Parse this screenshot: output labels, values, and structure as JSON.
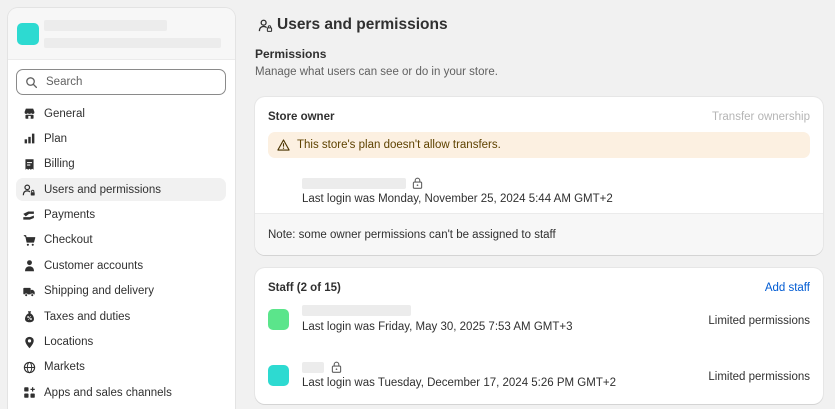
{
  "sidebar": {
    "search_placeholder": "Search",
    "items": [
      {
        "label": "General",
        "icon": "store-icon"
      },
      {
        "label": "Plan",
        "icon": "plan-icon"
      },
      {
        "label": "Billing",
        "icon": "billing-icon"
      },
      {
        "label": "Users and permissions",
        "icon": "users-icon",
        "active": true
      },
      {
        "label": "Payments",
        "icon": "payments-icon"
      },
      {
        "label": "Checkout",
        "icon": "cart-icon"
      },
      {
        "label": "Customer accounts",
        "icon": "person-icon"
      },
      {
        "label": "Shipping and delivery",
        "icon": "truck-icon"
      },
      {
        "label": "Taxes and duties",
        "icon": "taxes-icon"
      },
      {
        "label": "Locations",
        "icon": "location-icon"
      },
      {
        "label": "Markets",
        "icon": "globe-icon"
      },
      {
        "label": "Apps and sales channels",
        "icon": "apps-icon"
      }
    ]
  },
  "page": {
    "title": "Users and permissions",
    "section_title": "Permissions",
    "section_desc": "Manage what users can see or do in your store."
  },
  "owner": {
    "title": "Store owner",
    "transfer_label": "Transfer ownership",
    "banner": "This store's plan doesn't allow transfers.",
    "last_login": "Last login was Monday, November 25, 2024 5:44 AM GMT+2",
    "note": "Note: some owner permissions can't be assigned to staff"
  },
  "staff": {
    "title": "Staff (2 of 15)",
    "add_label": "Add staff",
    "members": [
      {
        "last_login": "Last login was Friday, May 30, 2025 7:53 AM GMT+3",
        "permissions": "Limited permissions",
        "avatar_color": "#5be58b"
      },
      {
        "last_login": "Last login was Tuesday, December 17, 2024 5:26 PM GMT+2",
        "permissions": "Limited permissions",
        "avatar_color": "#2ddad1"
      }
    ]
  },
  "colors": {
    "store_avatar": "#2ddad1",
    "link": "#005bd3",
    "banner_bg": "#fcf0e1"
  }
}
